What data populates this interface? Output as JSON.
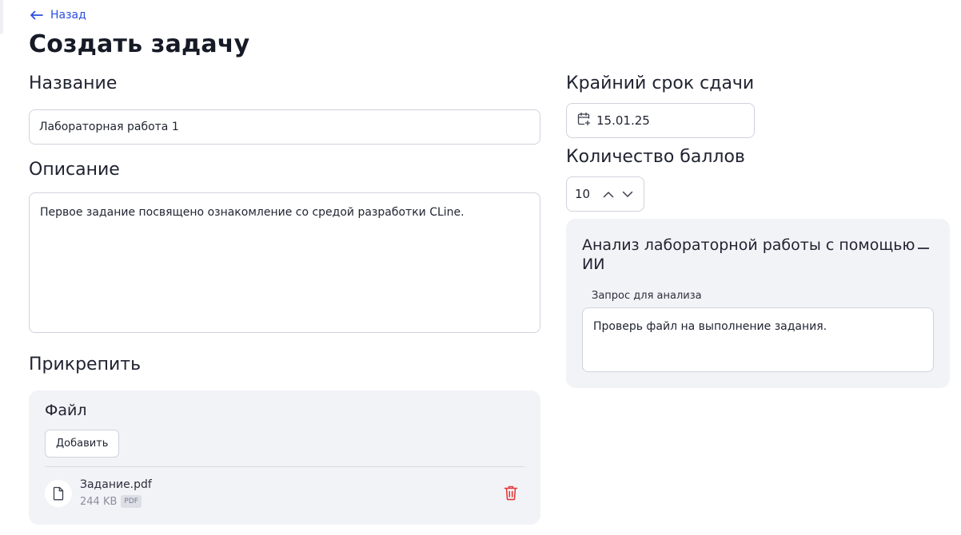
{
  "nav": {
    "back_label": "Назад"
  },
  "page": {
    "title": "Создать задачу"
  },
  "form": {
    "name_label": "Название",
    "name_value": "Лабораторная работа 1",
    "description_label": "Описание",
    "description_value": "Первое задание посвящено ознакомление со средой разработки CLine.",
    "attach_label": "Прикрепить",
    "deadline_label": "Крайний срок сдачи",
    "deadline_value": "15.01.25",
    "points_label": "Количество баллов",
    "points_value": "10"
  },
  "attachments": {
    "heading": "Файл",
    "add_label": "Добавить",
    "files": [
      {
        "name": "Задание.pdf",
        "size": "244 KB",
        "type": "PDF"
      }
    ]
  },
  "ai_analysis": {
    "title": "Анализ лабораторной работы с помощью ИИ",
    "prompt_label": "Запрос для анализа",
    "prompt_value": "Проверь файл на выполнение задания."
  },
  "colors": {
    "accent": "#2a4ee0",
    "danger": "#e03a3a",
    "panel": "#f2f3f7",
    "border": "#cfd3dc"
  },
  "icons": {
    "back": "arrow-left-icon",
    "calendar": "calendar-add-icon",
    "up": "chevron-up-icon",
    "down": "chevron-down-icon",
    "file": "file-icon",
    "delete": "trash-icon",
    "collapse": "minus-icon"
  }
}
